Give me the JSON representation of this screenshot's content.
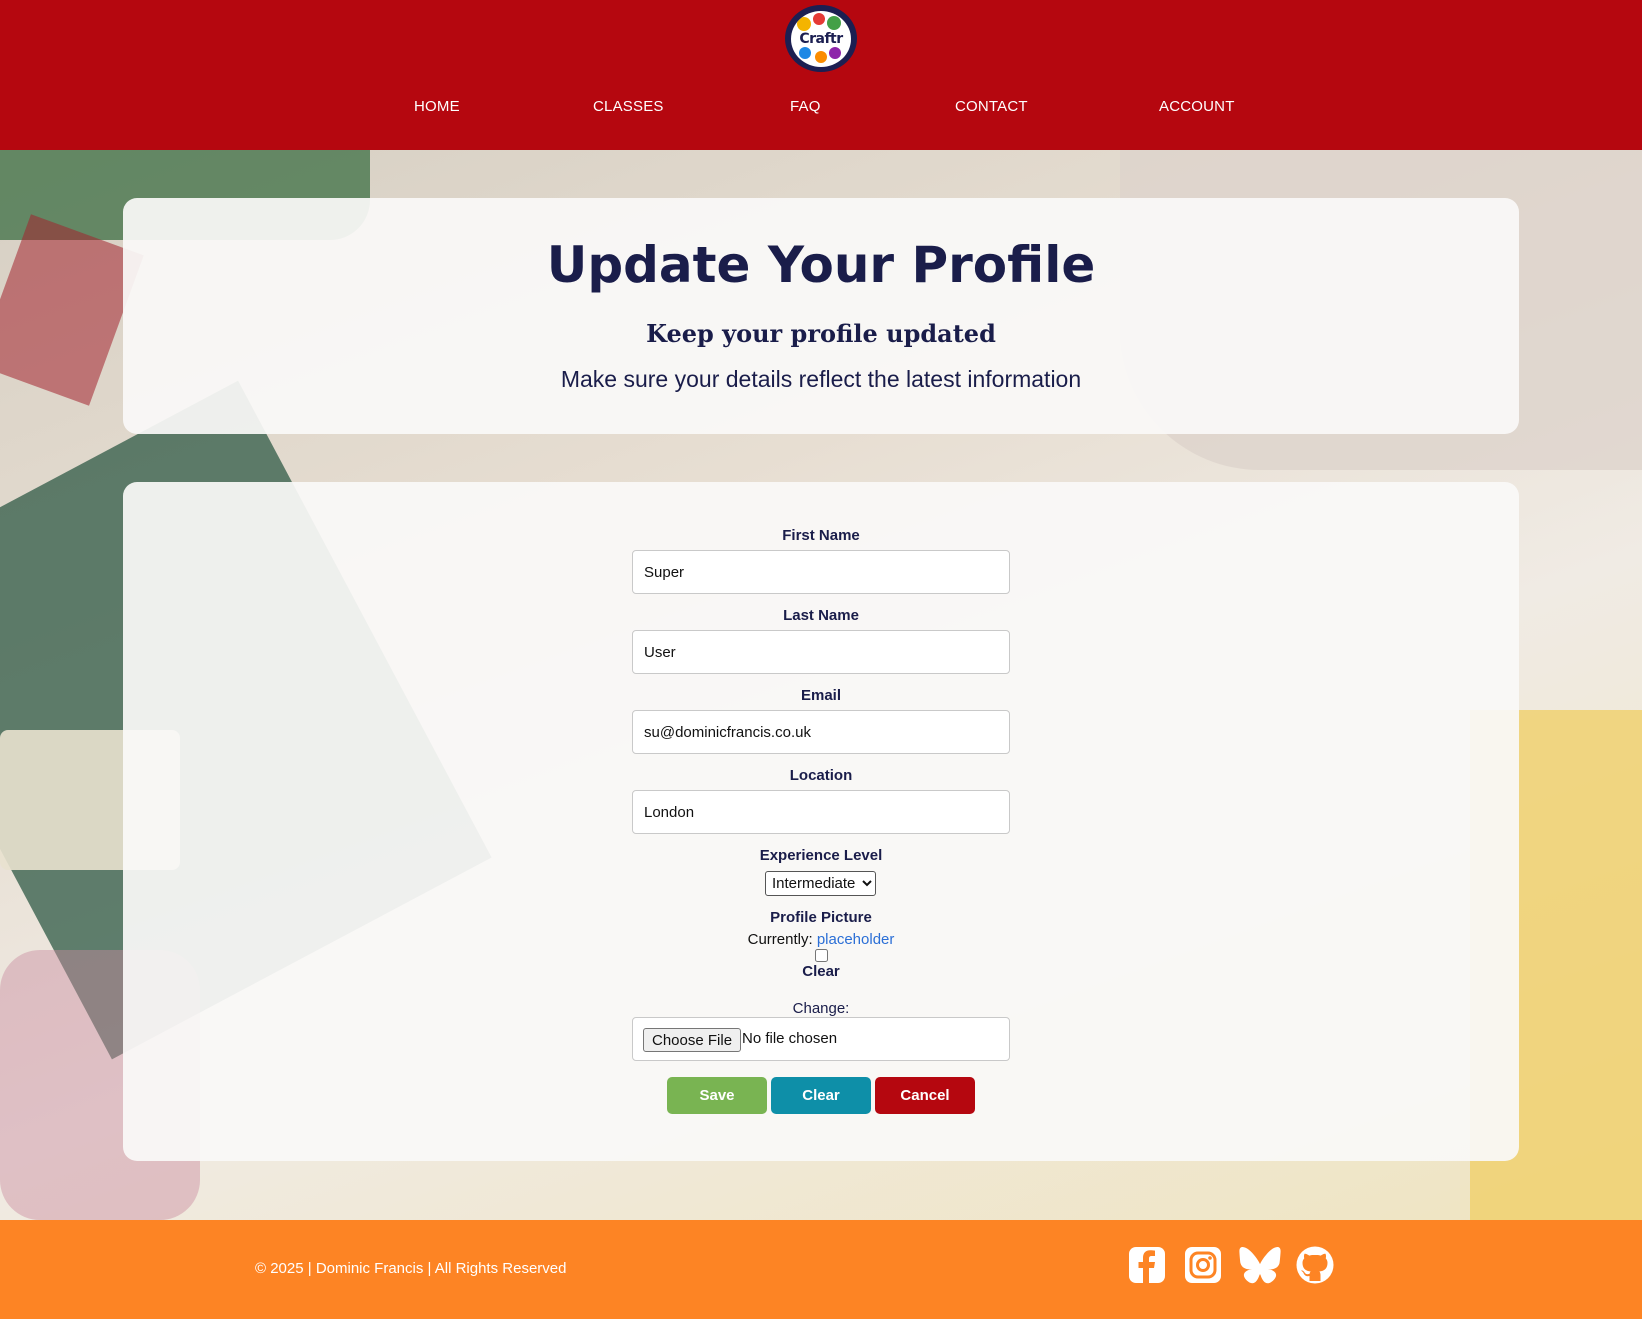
{
  "header": {
    "logo_text": "Craftr",
    "nav": [
      {
        "label": "HOME"
      },
      {
        "label": "CLASSES"
      },
      {
        "label": "FAQ"
      },
      {
        "label": "CONTACT"
      },
      {
        "label": "ACCOUNT"
      }
    ]
  },
  "intro": {
    "title": "Update Your Profile",
    "subtitle": "Keep your profile updated",
    "description": "Make sure your details reflect the latest information"
  },
  "form": {
    "first_name": {
      "label": "First Name",
      "value": "Super"
    },
    "last_name": {
      "label": "Last Name",
      "value": "User"
    },
    "email": {
      "label": "Email",
      "value": "su@dominicfrancis.co.uk"
    },
    "location": {
      "label": "Location",
      "value": "London"
    },
    "experience": {
      "label": "Experience Level",
      "selected": "Intermediate"
    },
    "profile_picture": {
      "label": "Profile Picture",
      "currently_label": "Currently:",
      "current_file": "placeholder",
      "clear_label": "Clear",
      "change_label": "Change:",
      "choose_button": "Choose File",
      "file_status": "No file chosen"
    },
    "buttons": {
      "save": "Save",
      "clear": "Clear",
      "cancel": "Cancel"
    }
  },
  "footer": {
    "copyright": "© 2025 | Dominic Francis | All Rights Reserved",
    "social": [
      "facebook-icon",
      "instagram-icon",
      "bluesky-icon",
      "github-icon"
    ]
  },
  "colors": {
    "header": "#b5070f",
    "footer": "#fd8424",
    "heading": "#1a1d4a",
    "save": "#79b452",
    "clear": "#0e8fa8",
    "cancel": "#b5070f"
  }
}
